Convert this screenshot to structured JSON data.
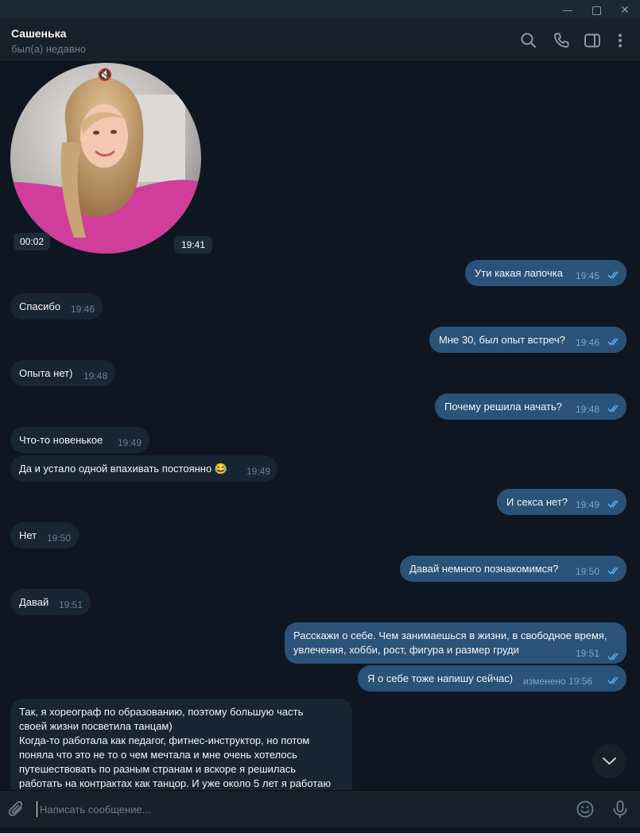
{
  "window": {
    "minimize_icon": "minimize-icon",
    "maximize_icon": "maximize-icon",
    "close_glyph": "✕"
  },
  "header": {
    "contact_name": "Сашенька",
    "contact_status": "был(а) недавно",
    "icons": [
      "search-icon",
      "phone-icon",
      "sidebar-toggle-icon",
      "more-vertical-icon"
    ]
  },
  "video_message": {
    "mute_glyph": "🔇",
    "duration": "00:02",
    "time": "19:41"
  },
  "messages": [
    {
      "dir": "out",
      "text": "Ути какая лапочка",
      "time": "19:45",
      "read": true
    },
    {
      "dir": "in",
      "text": "Спасибо",
      "time": "19:46"
    },
    {
      "dir": "out",
      "text": "Мне 30, был опыт встреч?",
      "time": "19:46",
      "read": true
    },
    {
      "dir": "in",
      "text": "Опыта нет)",
      "time": "19:48"
    },
    {
      "dir": "out",
      "text": "Почему решила начать?",
      "time": "19:48",
      "read": true
    },
    {
      "dir": "in",
      "text": "Что-то новенькое",
      "time": "19:49"
    },
    {
      "dir": "in",
      "text": "Да и устало одной впахивать постоянно 😂",
      "time": "19:49"
    },
    {
      "dir": "out",
      "text": "И секса нет?",
      "time": "19:49",
      "read": true
    },
    {
      "dir": "in",
      "text": "Нет",
      "time": "19:50"
    },
    {
      "dir": "out",
      "text": "Давай немного познакомимся?",
      "time": "19:50",
      "read": true
    },
    {
      "dir": "in",
      "text": "Давай",
      "time": "19:51"
    },
    {
      "dir": "out",
      "lines": [
        "Расскажи о себе. Чем занимаешься в жизни, в свободное время,",
        "увлечения, хобби, рост, фигура и размер груди"
      ],
      "time": "19:51",
      "read": true
    },
    {
      "dir": "out",
      "text": "Я о себе тоже напишу сейчас)",
      "time": "изменено 19:56",
      "read": true
    },
    {
      "dir": "in",
      "lines": [
        "Так, я хореограф по образованию, поэтому большую часть",
        "своей жизни посветила танцам)",
        "Когда-то работала как педагог, фитнес-инструктор, но потом",
        "поняла что это не то о чем мечтала и мне очень хотелось",
        "путешествовать по разным странам и вскоре я решилась",
        "работать на контрактах как танцор. И уже около 5 лет я работаю"
      ]
    }
  ],
  "scroll_down_icon": "chevron-down-icon",
  "composer": {
    "placeholder": "Написать сообщение...",
    "icons": [
      "attach-icon",
      "emoji-icon",
      "microphone-icon"
    ]
  },
  "colors": {
    "background": "#0e1621",
    "header": "#17212b",
    "incoming_bubble": "#182533",
    "outgoing_bubble": "#2b5278",
    "read_check": "#5fb0f5"
  }
}
